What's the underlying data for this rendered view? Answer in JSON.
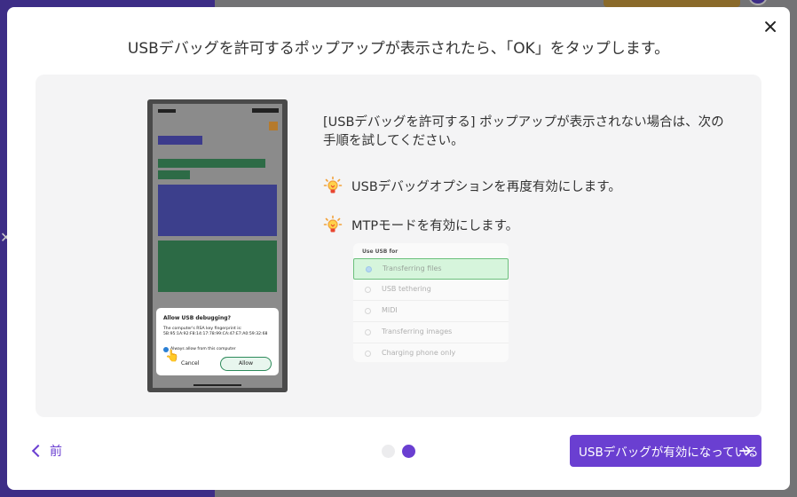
{
  "dialog": {
    "title": "USBデバッグを許可するポップアップが表示されたら、「OK」をタップします。",
    "hint": "[USBデバッグを許可する] ポップアップが表示されない場合は、次の手順を試してください。",
    "tips": [
      {
        "icon": "lightbulb-icon",
        "text": "USBデバッグオプションを再度有効にします。"
      },
      {
        "icon": "lightbulb-icon",
        "text": "MTPモードを有効にします。"
      }
    ],
    "phone_popup": {
      "title": "Allow USB debugging?",
      "body": "The computer's RSA key fingerprint is: 5B:95:1A:92:F8:14:17:78:99:CA:47:E7:A0:59:32:68",
      "checkbox_label": "Always allow from this computer",
      "cancel_label": "Cancel",
      "allow_label": "Allow"
    },
    "usb_options": {
      "header": "Use USB for",
      "items": [
        "Transferring files",
        "USB tethering",
        "MIDI",
        "Transferring images",
        "Charging phone only"
      ],
      "selected_index": 0
    },
    "footer": {
      "back_label": "前",
      "primary_label": "USBデバッグが有効になっている",
      "page_total": 2,
      "page_current": 2
    },
    "colors": {
      "accent": "#6a3fd1",
      "selected_green": "#d6f5dc"
    }
  }
}
